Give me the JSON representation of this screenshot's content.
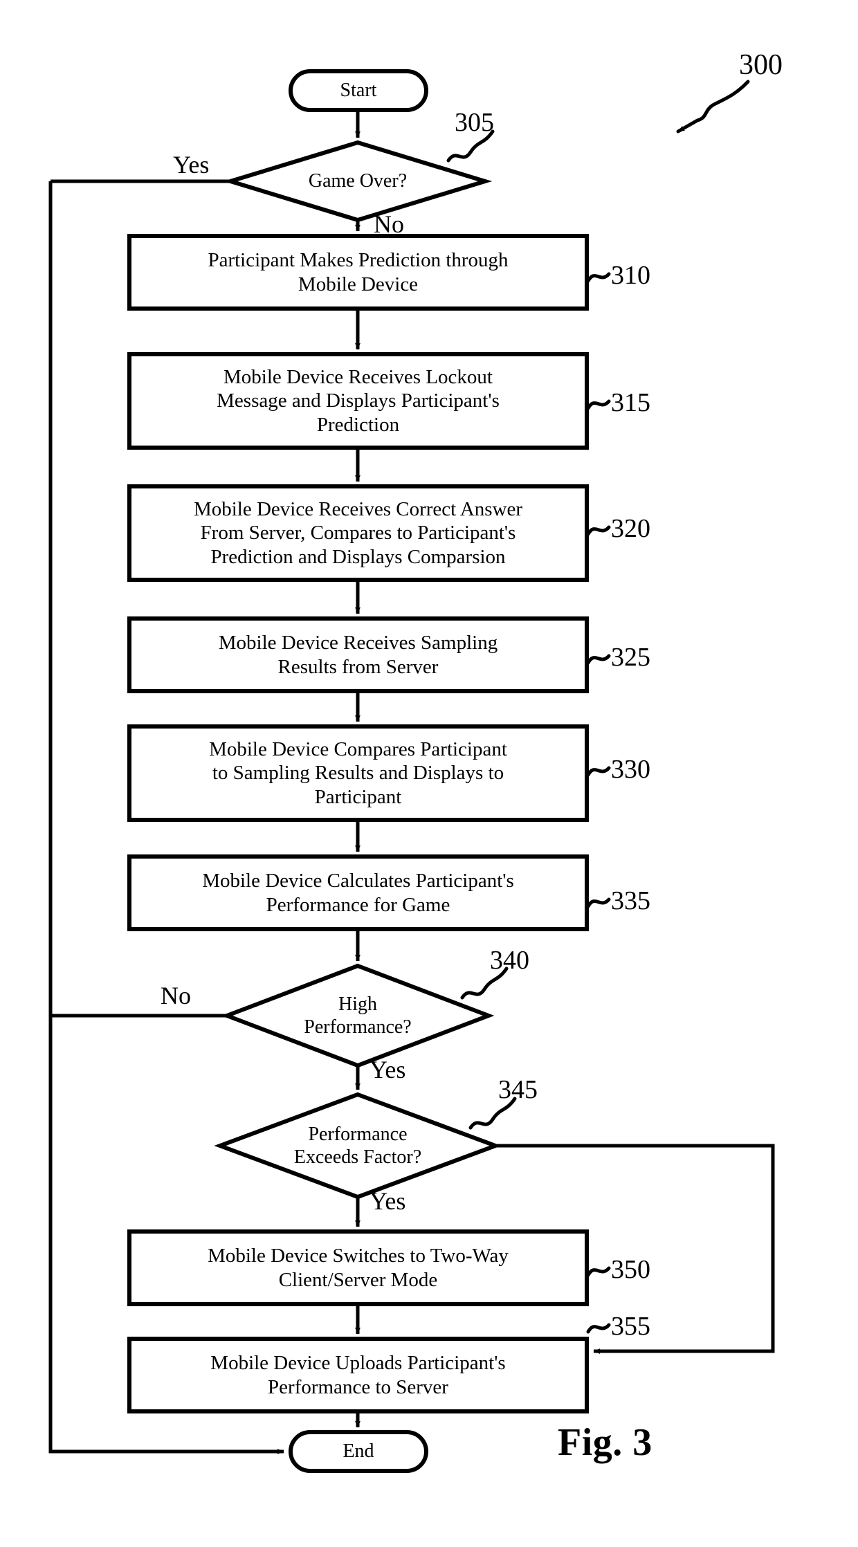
{
  "figure": {
    "caption": "Fig. 3",
    "diagram_number": "300",
    "type": "flowchart"
  },
  "nodes": {
    "start": {
      "label": "Start",
      "shape": "terminator"
    },
    "end": {
      "label": "End",
      "shape": "terminator"
    },
    "d305": {
      "ref": "305",
      "label": "Game Over?",
      "shape": "decision"
    },
    "p310": {
      "ref": "310",
      "label": "Participant Makes Prediction through\nMobile Device",
      "shape": "process"
    },
    "p315": {
      "ref": "315",
      "label": "Mobile Device Receives Lockout\nMessage and Displays Participant's\nPrediction",
      "shape": "process"
    },
    "p320": {
      "ref": "320",
      "label": "Mobile Device Receives Correct Answer\nFrom Server, Compares to Participant's\nPrediction and Displays Comparsion",
      "shape": "process"
    },
    "p325": {
      "ref": "325",
      "label": "Mobile Device Receives Sampling\nResults from Server",
      "shape": "process"
    },
    "p330": {
      "ref": "330",
      "label": "Mobile Device Compares Participant\nto Sampling Results and Displays to\nParticipant",
      "shape": "process"
    },
    "p335": {
      "ref": "335",
      "label": "Mobile Device Calculates Participant's\nPerformance for Game",
      "shape": "process"
    },
    "d340": {
      "ref": "340",
      "label": "High\nPerformance?",
      "shape": "decision"
    },
    "d345": {
      "ref": "345",
      "label": "Performance\nExceeds Factor?",
      "shape": "decision"
    },
    "p350": {
      "ref": "350",
      "label": "Mobile Device Switches to Two-Way\nClient/Server Mode",
      "shape": "process"
    },
    "p355": {
      "ref": "355",
      "label": "Mobile Device Uploads Participant's\nPerformance to Server",
      "shape": "process"
    }
  },
  "branch_labels": {
    "d305_yes": "Yes",
    "d305_no": "No",
    "d340_no": "No",
    "d340_yes": "Yes",
    "d345_yes": "Yes"
  },
  "colors": {
    "line": "#000000",
    "fill": "#ffffff",
    "text": "#000000"
  }
}
